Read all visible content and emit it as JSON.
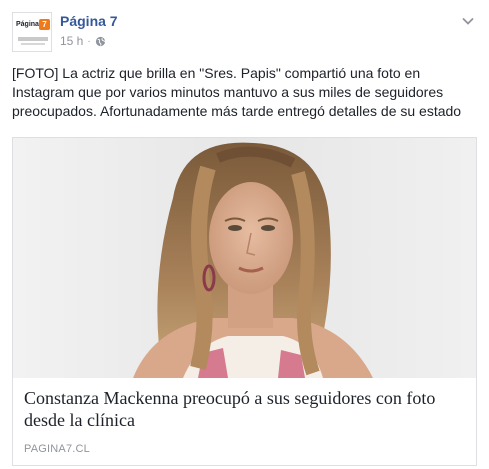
{
  "post": {
    "page_name": "Página 7",
    "timestamp": "15 h",
    "separator": "·",
    "privacy_icon": "globe-icon",
    "menu_icon": "chevron-down-icon",
    "avatar_text": "Página",
    "avatar_badge": "7",
    "caption": "[FOTO] La actriz que brilla en \"Sres. Papis\" compartió una foto en Instagram que por varios minutos mantuvo a sus miles de seguidores preocupados. Afortunadamente más tarde entregó detalles de su estado"
  },
  "link_card": {
    "title": "Constanza Mackenna preocupó a sus seguidores con foto desde la clínica",
    "domain": "PAGINA7.CL"
  },
  "colors": {
    "page_name": "#365899",
    "meta": "#90949c",
    "text": "#1d2129",
    "border": "#dddfe2",
    "logo_accent": "#f07a1a"
  }
}
